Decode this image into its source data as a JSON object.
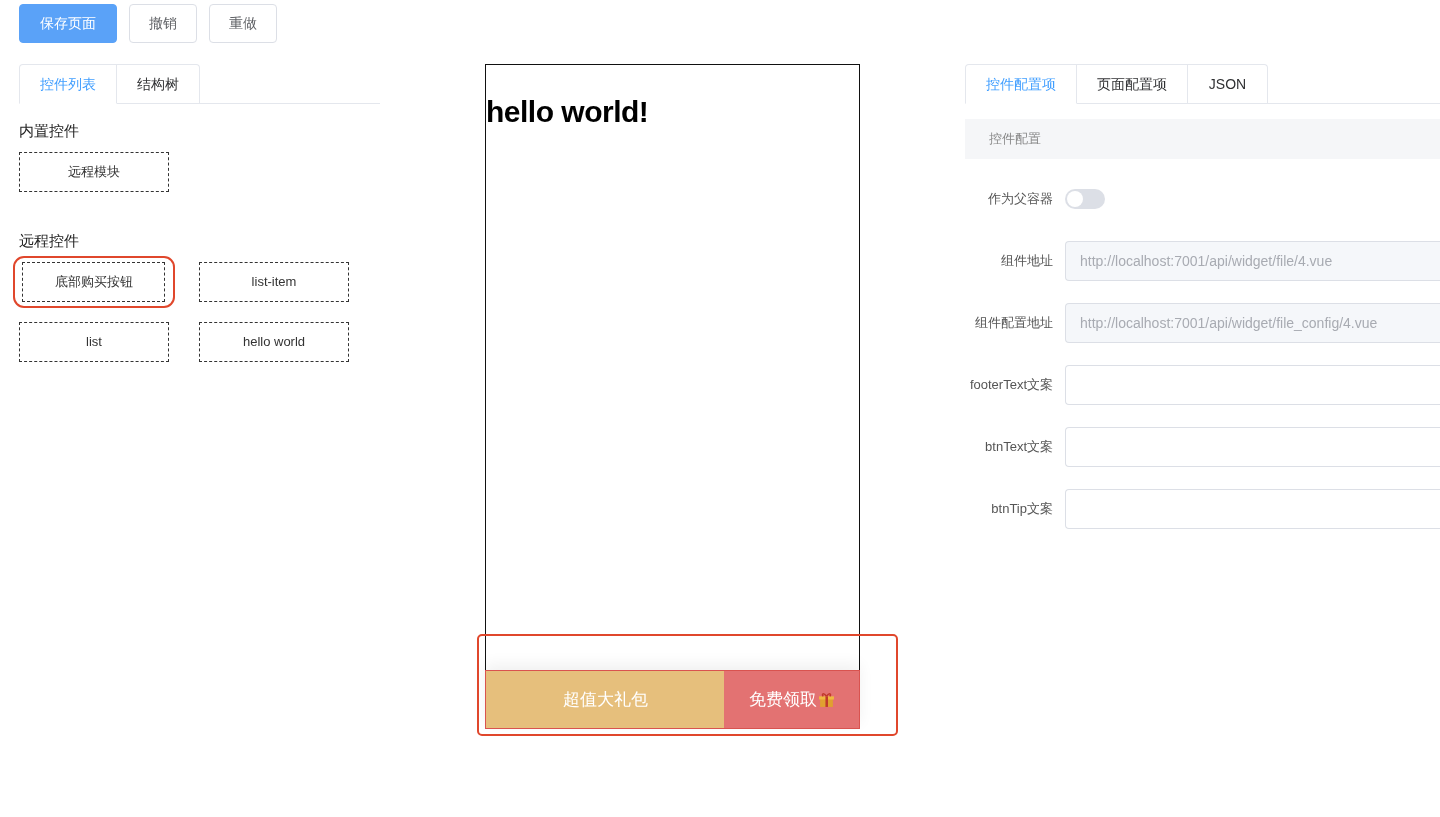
{
  "toolbar": {
    "buttons": [
      {
        "label": "保存页面",
        "kind": "primary"
      },
      {
        "label": "撤销",
        "kind": "default"
      },
      {
        "label": "重做",
        "kind": "default"
      }
    ]
  },
  "left_panel": {
    "tabs": [
      {
        "label": "控件列表",
        "selected": true
      },
      {
        "label": "结构树",
        "selected": false
      }
    ],
    "groups": [
      {
        "title": "内置控件",
        "items": [
          {
            "label": "远程模块",
            "highlighted": false
          }
        ]
      },
      {
        "title": "远程控件",
        "items": [
          {
            "label": "底部购买按钮",
            "highlighted": true
          },
          {
            "label": "list-item",
            "highlighted": false
          },
          {
            "label": "list",
            "highlighted": false
          },
          {
            "label": "hello world",
            "highlighted": false
          }
        ]
      }
    ]
  },
  "canvas": {
    "heading": "hello world!",
    "footer": {
      "left_text": "超值大礼包",
      "button_text": "免费领取",
      "highlighted": true
    }
  },
  "right_panel": {
    "tabs": [
      {
        "label": "控件配置项",
        "selected": true
      },
      {
        "label": "页面配置项",
        "selected": false
      },
      {
        "label": "JSON",
        "selected": false
      }
    ],
    "section_title": "控件配置",
    "fields": [
      {
        "label": "作为父容器",
        "kind": "switch",
        "on": false
      },
      {
        "label": "组件地址",
        "kind": "input",
        "value": "http://localhost:7001/api/widget/file/4.vue",
        "disabled": true
      },
      {
        "label": "组件配置地址",
        "kind": "input",
        "value": "http://localhost:7001/api/widget/file_config/4.vue",
        "disabled": true
      },
      {
        "label": "footerText文案",
        "kind": "input"
      },
      {
        "label": "btnText文案",
        "kind": "input"
      },
      {
        "label": "btnTip文案",
        "kind": "input"
      }
    ]
  }
}
